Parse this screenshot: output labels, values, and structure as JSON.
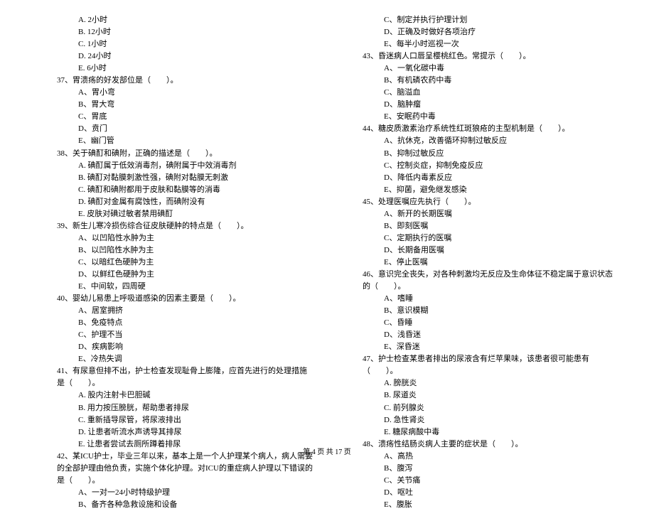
{
  "footer": "第 4 页 共 17 页",
  "left": {
    "q36_opts": [
      "A. 2小时",
      "B. 12小时",
      "C. 1小时",
      "D. 24小时",
      "E. 6小时"
    ],
    "q37": "37、胃溃疡的好发部位是（　　）。",
    "q37_opts": [
      "A、胃小弯",
      "B、胃大弯",
      "C、胃底",
      "D、贲门",
      "E、幽门管"
    ],
    "q38": "38、关于碘酊和碘附，正确的描述是（　　）。",
    "q38_opts": [
      "A. 碘酊属于低效消毒剂，碘附属于中效消毒剂",
      "B. 碘酊对黏膜刺激性强，碘附对黏膜无刺激",
      "C. 碘酊和碘附都用于皮肤和黏膜等的消毒",
      "D. 碘酊对金属有腐蚀性，而碘附没有",
      "E. 皮肤对碘过敏者禁用碘酊"
    ],
    "q39": "39、新生儿寒冷损伤综合征皮肤硬肿的特点是（　　）。",
    "q39_opts": [
      "A、以凹陷性水肿为主",
      "B、以凹陷性水肿为主",
      "C、以暗红色硬肿为主",
      "D、以鲜红色硬肿为主",
      "E、中间软，四周硬"
    ],
    "q40": "40、婴幼儿易患上呼吸道感染的因素主要是（　　）。",
    "q40_opts": [
      "A、居室拥挤",
      "B、免疫特点",
      "C、护理不当",
      "D、疾病影响",
      "E、冷热失调"
    ],
    "q41": "41、有尿意但排不出，护士检查发现耻骨上膨隆，应首先进行的处理措施是（　　）。",
    "q41_opts": [
      "A. 股内注射卡巴胆碱",
      "B. 用力按压膀胱，帮助患者排尿",
      "C. 重新插导尿管，将尿液排出",
      "D. 让患者听流水声诱导其排尿",
      "E. 让患者尝试去厕所蹲着排尿"
    ],
    "q42": "42、某ICU护士，毕业三年以来，基本上是一个人护理某个病人，病人需要的全部护理由他负责，实施个体化护理。对ICU的重症病人护理以下错误的是（　　）。",
    "q42_opts": [
      "A、一对一24小时特级护理",
      "B、备齐各种急救设施和设备"
    ]
  },
  "right": {
    "q42_opts_cont": [
      "C、制定并执行护理计划",
      "D、正确及时做好各项治疗",
      "E、每半小时巡视一次"
    ],
    "q43": "43、昏迷病人口唇呈樱桃红色。常提示（　　）。",
    "q43_opts": [
      "A、一氧化碳中毒",
      "B、有机磷农药中毒",
      "C、脑溢血",
      "D、脑肿瘤",
      "E、安眠药中毒"
    ],
    "q44": "44、糖皮质激素治疗系统性红斑狼疮的主型机制是（　　）。",
    "q44_opts": [
      "A、抗休克，改善循环抑制过敏反应",
      "B、抑制过敏反应",
      "C、控制炎症，抑制免疫反应",
      "D、降低内毒素反应",
      "E、抑菌，避免继发感染"
    ],
    "q45": "45、处理医嘱应先执行（　　）。",
    "q45_opts": [
      "A、新开的长期医嘱",
      "B、即刻医嘱",
      "C、定期执行的医嘱",
      "D、长期备用医嘱",
      "E、停止医嘱"
    ],
    "q46": "46、意识完全丧失，对各种刺激均无反应及生命体征不稳定属于意识状态的（　　）。",
    "q46_opts": [
      "A、嗜睡",
      "B、意识模糊",
      "C、昏睡",
      "D、浅昏迷",
      "E、深昏迷"
    ],
    "q47": "47、护士检查某患者排出的尿液含有烂苹果味，该患者很可能患有（　　）。",
    "q47_opts": [
      "A. 膀胱炎",
      "B. 尿道炎",
      "C. 前列腺炎",
      "D. 急性肾炎",
      "E. 糖尿病酸中毒"
    ],
    "q48": "48、溃疡性结肠炎病人主要的症状是（　　）。",
    "q48_opts": [
      "A、高热",
      "B、腹泻",
      "C、关节痛",
      "D、呕吐",
      "E、腹胀"
    ]
  }
}
